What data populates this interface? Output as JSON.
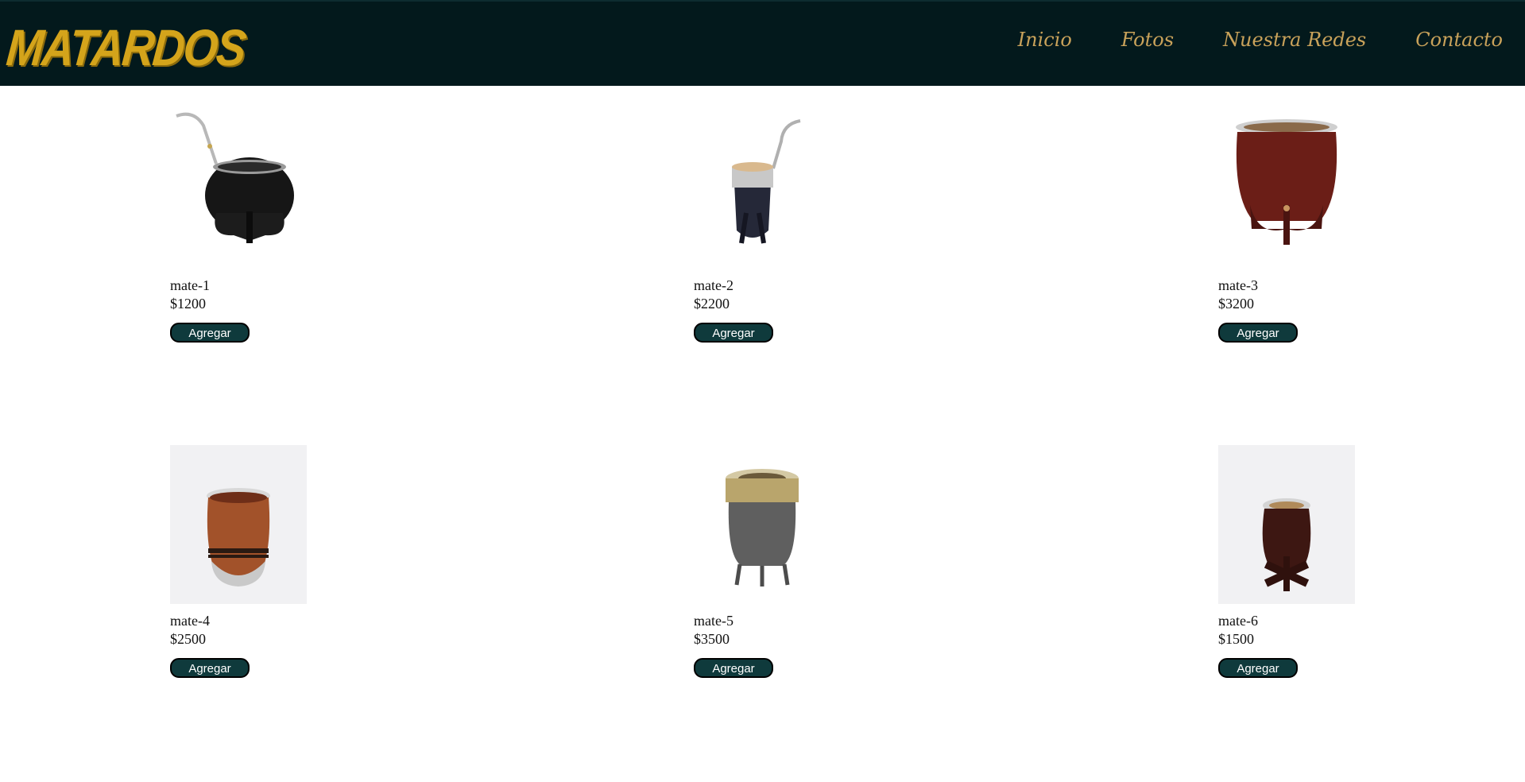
{
  "header": {
    "logo": "MATARDOS",
    "nav": [
      "Inicio",
      "Fotos",
      "Nuestra Redes",
      "Contacto"
    ]
  },
  "products": [
    {
      "name": "mate-1",
      "price": "$1200",
      "button": "Agregar"
    },
    {
      "name": "mate-2",
      "price": "$2200",
      "button": "Agregar"
    },
    {
      "name": "mate-3",
      "price": "$3200",
      "button": "Agregar"
    },
    {
      "name": "mate-4",
      "price": "$2500",
      "button": "Agregar"
    },
    {
      "name": "mate-5",
      "price": "$3500",
      "button": "Agregar"
    },
    {
      "name": "mate-6",
      "price": "$1500",
      "button": "Agregar"
    }
  ],
  "colors": {
    "navbar": "#03191c",
    "logo": "#d4a41b",
    "nav_link": "#c9a25a",
    "button": "#0f3a3c"
  }
}
